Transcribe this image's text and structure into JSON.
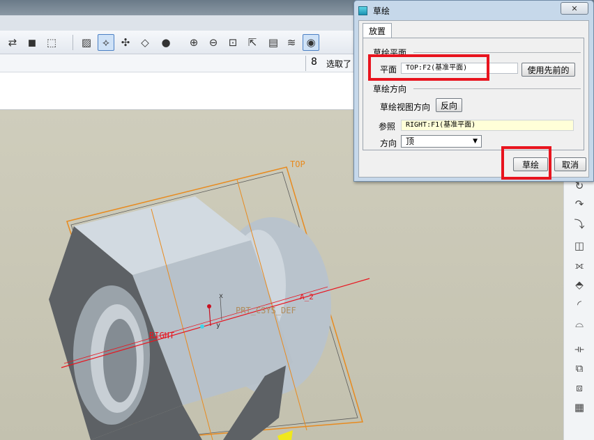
{
  "dialog": {
    "title": "草绘",
    "close_label": "✕",
    "tab_label": "放置",
    "sketch_plane_group": "草绘平面",
    "plane_label": "平面",
    "plane_value": "TOP:F2(基准平面)",
    "use_previous_label": "使用先前的",
    "orientation_group": "草绘方向",
    "view_direction_label": "草绘视图方向",
    "flip_label": "反向",
    "reference_label": "参照",
    "reference_value": "RIGHT:F1(基准平面)",
    "direction_label": "方向",
    "direction_value": "顶",
    "sketch_button": "草绘",
    "cancel_button": "取消"
  },
  "toolbar": {
    "pick_label": "选取了",
    "icons": [
      "regenerate-icon",
      "find-icon",
      "select-box-icon",
      "datum-display-icon",
      "spin-center-icon",
      "csys-icon",
      "view-manager-icon",
      "shading-icon",
      "zoom-in-icon",
      "zoom-out-icon",
      "refit-icon",
      "reorient-icon",
      "layers-icon",
      "named-view-icon"
    ]
  },
  "viewport": {
    "top_plane_label": "TOP",
    "right_plane_label": "RIGHT",
    "csys_label": "PRT_CSYS_DEF",
    "axis_label": "A_2",
    "x_label": "x",
    "y_label": "y"
  },
  "colors": {
    "highlight": "#e8141e",
    "datum_plane": "#e88a1e",
    "dialog_frame": "#c6d8ea"
  }
}
